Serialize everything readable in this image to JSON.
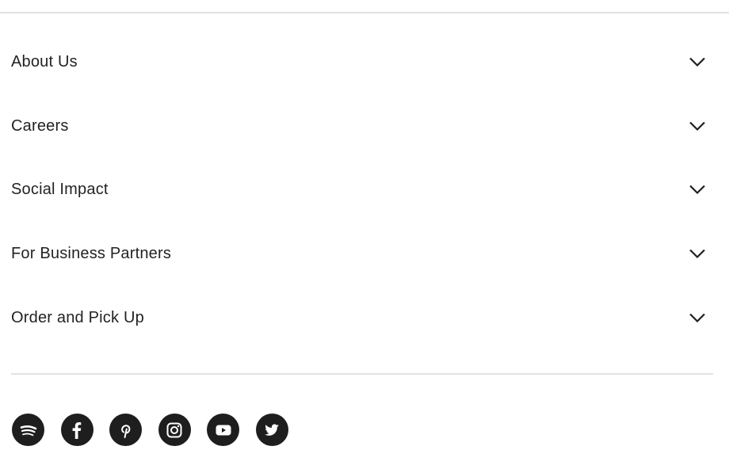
{
  "sections": [
    {
      "label": "About Us"
    },
    {
      "label": "Careers"
    },
    {
      "label": "Social Impact"
    },
    {
      "label": "For Business Partners"
    },
    {
      "label": "Order and Pick Up"
    }
  ],
  "social": [
    "spotify-icon",
    "facebook-icon",
    "pinterest-icon",
    "instagram-icon",
    "youtube-icon",
    "twitter-icon"
  ]
}
